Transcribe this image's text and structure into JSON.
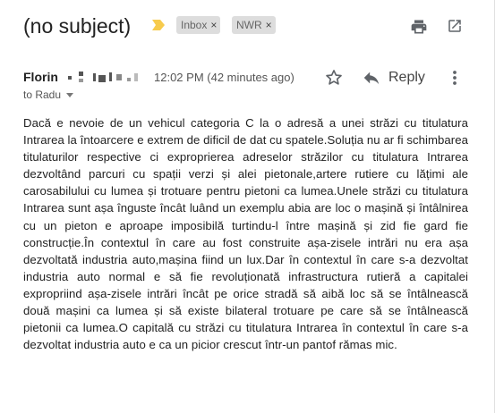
{
  "subject": "(no subject)",
  "labels": [
    "Inbox",
    "NWR"
  ],
  "label_remove_glyph": "×",
  "sender": {
    "name": "Florin",
    "timestamp": "12:02 PM (42 minutes ago)",
    "reply_label": "Reply",
    "to": "to Radu"
  },
  "body": "Dacă e nevoie de un vehicul categoria C la o adresă a unei străzi cu titulatura Intrarea la întoarcere e extrem de dificil de dat cu spatele.Soluția nu ar fi schimbarea titulaturilor respective ci exproprierea adreselor străzilor cu titulatura Intrarea dezvoltând parcuri cu spații verzi și alei pietonale,artere rutiere cu lățimi ale carosabilului cu lumea și trotuare pentru pietoni ca lumea.Unele străzi cu titulatura Intrarea sunt așa înguste încât luând un exemplu abia are loc o mașină și întâlnirea cu un pieton e aproape imposibilă turtindu-l între mașină și zid fie gard fie construcție.În contextul în care au fost construite așa-zisele intrări nu era așa dezvoltată industria auto,mașina fiind un lux.Dar în contextul în care s-a dezvoltat industria auto normal e să fie revoluționată infrastructura rutieră a capitalei expropriind așa-zisele intrări încât pe orice stradă să aibă loc să se întâlnească două mașini ca lumea și să existe bilateral trotuare pe care să se întâlnească pietonii ca lumea.O capitală cu străzi cu titulatura Intrarea în contextul în care s-a dezvoltat industria auto e ca un picior crescut într-un pantof rămas mic.",
  "icons": {
    "importance": "importance-marker-icon",
    "print": "print-icon",
    "popout": "open-in-new-window-icon",
    "star": "star-icon",
    "reply": "reply-arrow-icon",
    "more": "more-vertical-icon",
    "to_dropdown": "chevron-down-icon"
  },
  "colors": {
    "importance": "#f7cb4d",
    "chip_bg": "#dddddd",
    "icon": "#5f6368"
  }
}
